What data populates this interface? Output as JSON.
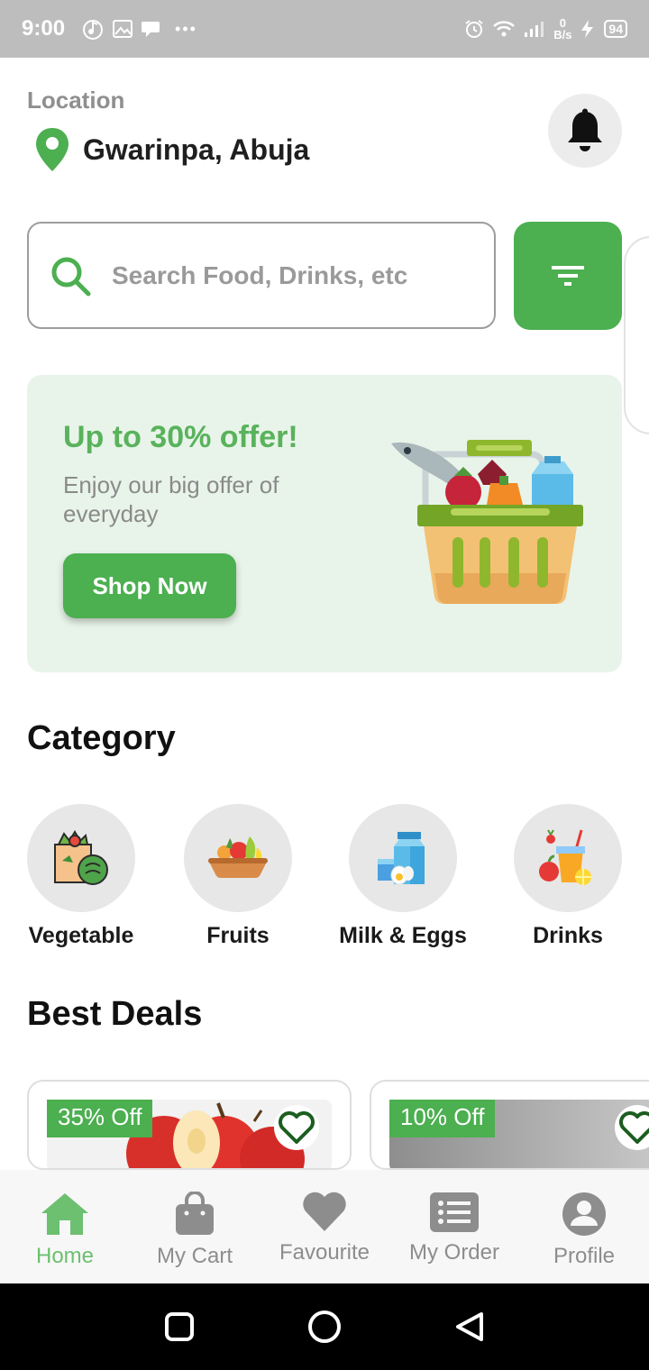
{
  "status_bar": {
    "time": "9:00",
    "dots": "•••",
    "net_speed_value": "0",
    "net_speed_unit": "B/s",
    "battery": "94",
    "icons_left": [
      "music-icon",
      "image-icon",
      "chat-icon"
    ],
    "icons_right": [
      "alarm-icon",
      "wifi-icon",
      "signal-icon",
      "charging-icon"
    ]
  },
  "header": {
    "location_label": "Location",
    "location_value": "Gwarinpa, Abuja",
    "bell_icon": "bell-icon"
  },
  "search": {
    "placeholder": "Search Food, Drinks, etc",
    "value": ""
  },
  "promo": {
    "title": "Up to 30% offer!",
    "subtitle": "Enjoy our big offer of everyday",
    "button_label": "Shop Now"
  },
  "category": {
    "title": "Category",
    "items": [
      {
        "label": "Vegetable",
        "icon": "vegetable-bag-icon"
      },
      {
        "label": "Fruits",
        "icon": "fruit-bowl-icon"
      },
      {
        "label": "Milk & Eggs",
        "icon": "milk-eggs-icon"
      },
      {
        "label": "Drinks",
        "icon": "drinks-icon"
      }
    ]
  },
  "best_deals": {
    "title": "Best Deals",
    "items": [
      {
        "badge": "35% Off"
      },
      {
        "badge": "10% Off"
      }
    ]
  },
  "bottom_nav": {
    "items": [
      {
        "label": "Home",
        "icon": "home-icon",
        "active": true
      },
      {
        "label": "My Cart",
        "icon": "shopping-bag-icon",
        "active": false
      },
      {
        "label": "Favourite",
        "icon": "heart-icon",
        "active": false
      },
      {
        "label": "My Order",
        "icon": "order-list-icon",
        "active": false
      },
      {
        "label": "Profile",
        "icon": "profile-icon",
        "active": false
      }
    ]
  },
  "colors": {
    "accent": "#4caf50",
    "promo_bg": "#e8f4e9",
    "promo_title": "#59b25c",
    "nav_active": "#6cc070"
  }
}
